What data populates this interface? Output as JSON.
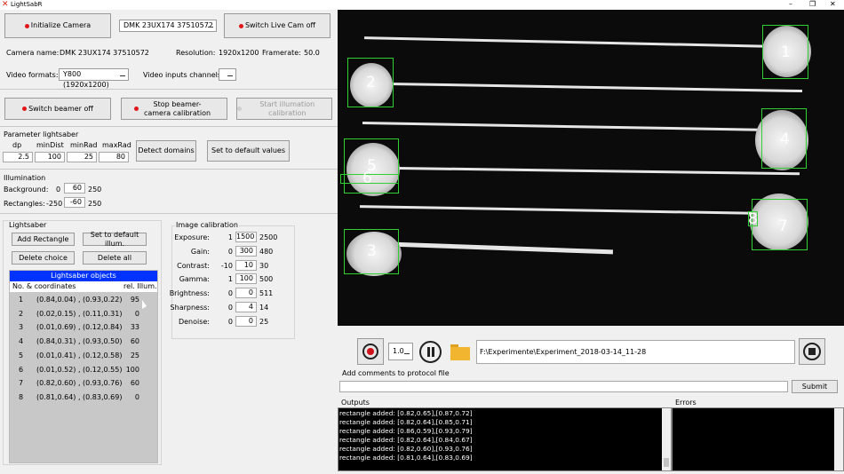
{
  "window": {
    "title": "LightSabR"
  },
  "camera_panel": {
    "init_label": "Initialize Camera",
    "device": "DMK 23UX174 37510572",
    "live_label": "Switch Live Cam off",
    "camera_name_label": "Camera name:",
    "camera_name_value": "DMK 23UX174 37510572",
    "resolution_label": "Resolution:",
    "resolution_value": "1920x1200",
    "framerate_label": "Framerate:",
    "framerate_value": "50.0",
    "formats_label": "Video formats:",
    "formats_value": "Y800 (1920x1200)",
    "channels_label": "Video inputs channels:",
    "beamer_off_label": "Switch beamer off",
    "stop_calib_label": "Stop beamer-camera calibration",
    "start_illum_label": "Start illumation calibration"
  },
  "parameter": {
    "title": "Parameter lightsaber",
    "headers": [
      "dp",
      "minDist",
      "minRad",
      "maxRad"
    ],
    "values": [
      "2.5",
      "100",
      "25",
      "80"
    ],
    "detect_label": "Detect domains",
    "default_label": "Set to default values"
  },
  "illumination": {
    "title": "Illumination",
    "background_label": "Background:",
    "background_min": "0",
    "background_value": "60",
    "background_max": "250",
    "rect_label": "Rectangles:",
    "rect_min": "-250",
    "rect_value": "-60",
    "rect_max": "250"
  },
  "lightsaber": {
    "title": "Lightsaber",
    "add_label": "Add Rectangle",
    "default_illum_label": "Set to default illum.",
    "delete_choice_label": "Delete choice",
    "delete_all_label": "Delete all",
    "objects_title": "Lightsaber objects",
    "col_coords": "No. & coordinates",
    "col_illum": "rel. Illum.",
    "rows": [
      {
        "no": "1",
        "coords": "(0.84,0.04) , (0.93,0.22)",
        "illum": "95"
      },
      {
        "no": "2",
        "coords": "(0.02,0.15) , (0.11,0.31)",
        "illum": "0"
      },
      {
        "no": "3",
        "coords": "(0.01,0.69) , (0.12,0.84)",
        "illum": "33"
      },
      {
        "no": "4",
        "coords": "(0.84,0.31) , (0.93,0.50)",
        "illum": "60"
      },
      {
        "no": "5",
        "coords": "(0.01,0.41) , (0.12,0.58)",
        "illum": "25"
      },
      {
        "no": "6",
        "coords": "(0.01,0.52) , (0.12,0.55)",
        "illum": "100"
      },
      {
        "no": "7",
        "coords": "(0.82,0.60) , (0.93,0.76)",
        "illum": "60"
      },
      {
        "no": "8",
        "coords": "(0.81,0.64) , (0.83,0.69)",
        "illum": "0"
      }
    ]
  },
  "image_calibration": {
    "title": "Image calibration",
    "params": [
      {
        "label": "Exposure:",
        "min": "1",
        "value": "1500",
        "max": "2500"
      },
      {
        "label": "Gain:",
        "min": "0",
        "value": "300",
        "max": "480"
      },
      {
        "label": "Contrast:",
        "min": "-10",
        "value": "10",
        "max": "30"
      },
      {
        "label": "Gamma:",
        "min": "1",
        "value": "100",
        "max": "500"
      },
      {
        "label": "Brightness:",
        "min": "0",
        "value": "0",
        "max": "511"
      },
      {
        "label": "Sharpness:",
        "min": "0",
        "value": "4",
        "max": "14"
      },
      {
        "label": "Denoise:",
        "min": "0",
        "value": "0",
        "max": "25"
      }
    ]
  },
  "camera_view": {
    "rois": [
      "1",
      "2",
      "3",
      "4",
      "5",
      "6",
      "7",
      "8"
    ]
  },
  "transport": {
    "speed": "1.0",
    "path": "F:\\Experimente\\Experiment_2018-03-14_11-28"
  },
  "comments": {
    "label": "Add comments to protocol file",
    "value": "",
    "submit_label": "Submit"
  },
  "outputs": {
    "title": "Outputs",
    "lines": [
      "rectangle added: [0.82,0.65],[0.87,0.72]",
      "rectangle added: [0.82,0.64],[0.85,0.71]",
      "rectangle added: [0.86,0.59],[0.93,0.79]",
      "rectangle added: [0.82,0.64],[0.84,0.67]",
      "rectangle added: [0.82,0.60],[0.93,0.76]",
      "rectangle added: [0.81,0.64],[0.83,0.69]"
    ]
  },
  "errors": {
    "title": "Errors"
  }
}
